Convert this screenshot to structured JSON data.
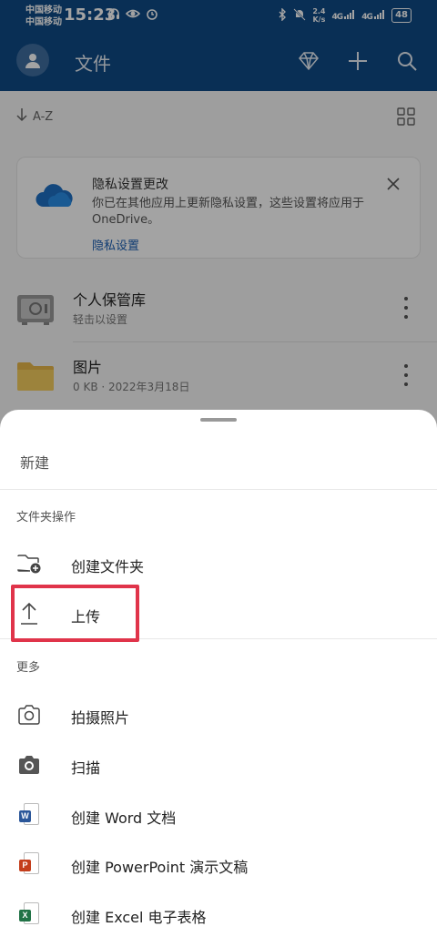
{
  "status_bar": {
    "carrier_1": "中国移动",
    "carrier_2": "中国移动",
    "time": "15:23",
    "speed_value": "2.4",
    "speed_unit": "K/s",
    "signal_1": "4G",
    "signal_2": "4G",
    "battery": "48"
  },
  "header": {
    "title": "文件",
    "icons": [
      "avatar-icon",
      "diamond-icon",
      "plus-icon",
      "search-icon"
    ],
    "background": "#0f4a85"
  },
  "toolbar": {
    "sort_label": "A-Z"
  },
  "privacy_card": {
    "title": "隐私设置更改",
    "message": "你已在其他应用上更新隐私设置，这些设置将应用于 OneDrive。",
    "link": "隐私设置",
    "link_color": "#1a5fb4"
  },
  "files": [
    {
      "name": "个人保管库",
      "sub": "轻击以设置",
      "icon": "vault-icon"
    },
    {
      "name": "图片",
      "sub": "0 KB · 2022年3月18日",
      "icon": "folder-icon"
    }
  ],
  "sheet": {
    "title": "新建",
    "section_folder": "文件夹操作",
    "section_more": "更多",
    "items": [
      {
        "label": "创建文件夹",
        "icon": "create-folder-icon"
      },
      {
        "label": "上传",
        "icon": "upload-icon"
      },
      {
        "label": "拍摄照片",
        "icon": "camera-icon"
      },
      {
        "label": "扫描",
        "icon": "scan-camera-icon"
      },
      {
        "label": "创建 Word 文档",
        "icon": "word-icon",
        "badge": "W"
      },
      {
        "label": "创建 PowerPoint 演示文稿",
        "icon": "powerpoint-icon",
        "badge": "P"
      },
      {
        "label": "创建 Excel 电子表格",
        "icon": "excel-icon",
        "badge": "X"
      }
    ],
    "highlight_color": "#e0344a"
  }
}
